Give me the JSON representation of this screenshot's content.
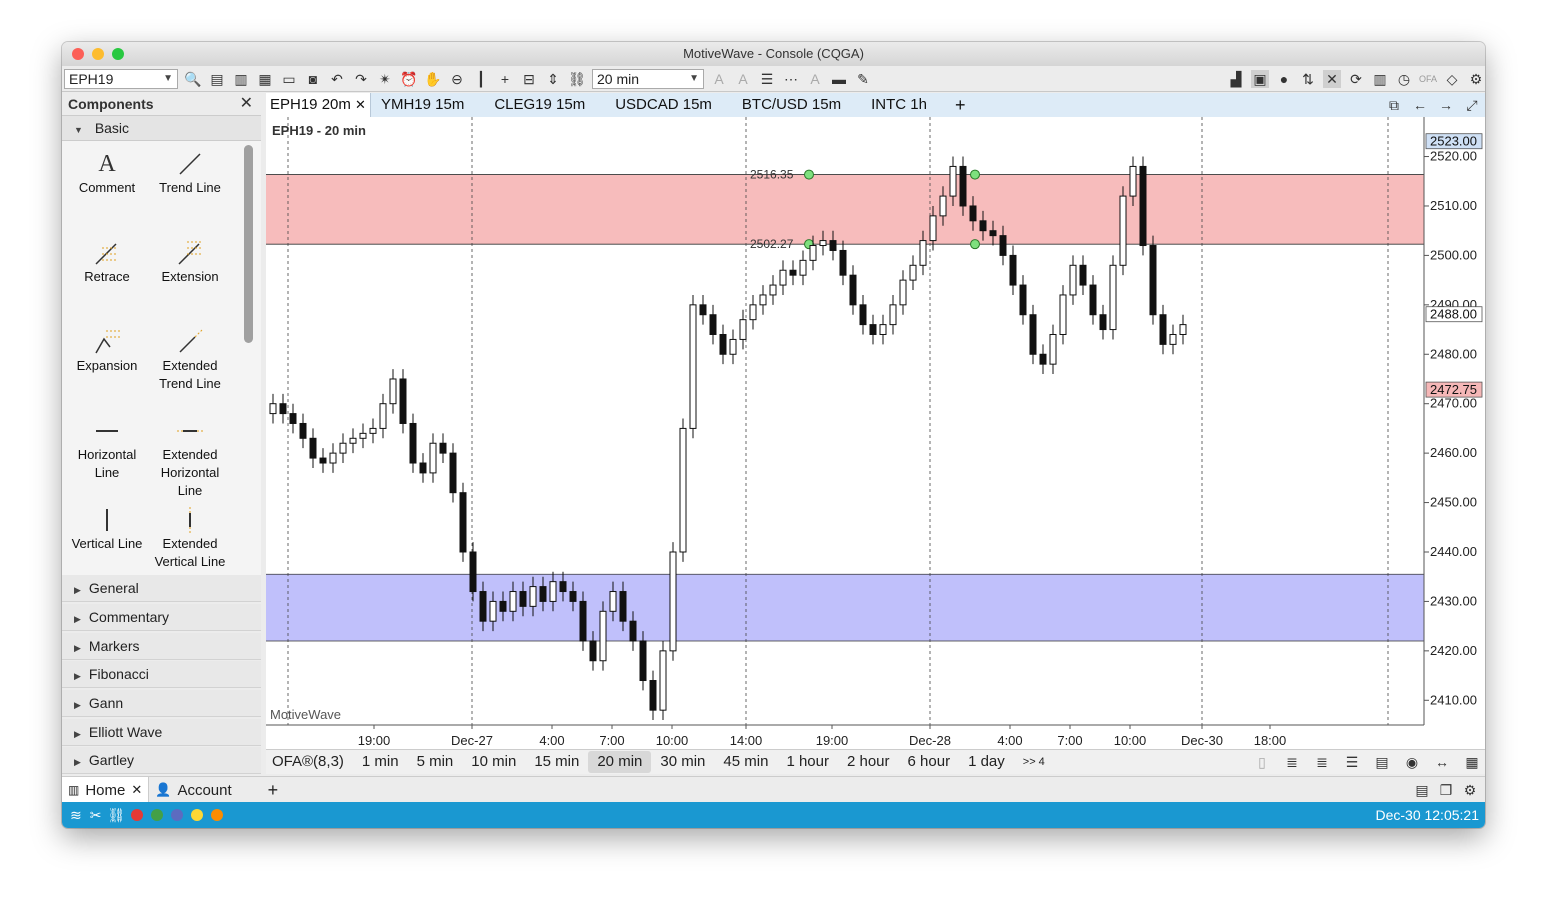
{
  "window": {
    "title": "MotiveWave - Console (CQGA)",
    "traffic_lights": [
      "#fc5f57",
      "#fdbc2e",
      "#28c840"
    ]
  },
  "toolbar": {
    "symbol": "EPH19",
    "timeframe": "20 min"
  },
  "components": {
    "title": "Components",
    "basic_section": "Basic",
    "tools": [
      {
        "label": "Comment",
        "icon": "text-icon"
      },
      {
        "label": "Trend Line",
        "icon": "trend-line-icon"
      },
      {
        "label": "Retrace",
        "icon": "retrace-icon"
      },
      {
        "label": "Extension",
        "icon": "extension-icon"
      },
      {
        "label": "Expansion",
        "icon": "expansion-icon"
      },
      {
        "label": "Extended Trend Line",
        "icon": "extended-trend-line-icon"
      },
      {
        "label": "Horizontal Line",
        "icon": "horizontal-line-icon"
      },
      {
        "label": "Extended Horizontal Line",
        "icon": "extended-horizontal-line-icon"
      },
      {
        "label": "Vertical Line",
        "icon": "vertical-line-icon"
      },
      {
        "label": "Extended Vertical Line",
        "icon": "extended-vertical-line-icon"
      }
    ],
    "categories": [
      "General",
      "Commentary",
      "Markers",
      "Fibonacci",
      "Gann",
      "Elliott Wave",
      "Gartley"
    ]
  },
  "chart_tabs": [
    "EPH19 20m",
    "YMH19 15m",
    "CLEG19 15m",
    "USDCAD 15m",
    "BTC/USD 15m",
    "INTC 1h"
  ],
  "chart": {
    "title": "EPH19 - 20 min",
    "watermark": "MotiveWave",
    "price_labels": [
      "2520.00",
      "2510.00",
      "2500.00",
      "2490.00",
      "2480.00",
      "2470.00",
      "2460.00",
      "2450.00",
      "2440.00",
      "2430.00",
      "2420.00",
      "2410.00"
    ],
    "price_badges": [
      {
        "text": "2523.00",
        "value": 2523.0,
        "color": "#cfe0f5"
      },
      {
        "text": "2488.00",
        "value": 2488.0,
        "color": "#ffffff"
      },
      {
        "text": "2472.75",
        "value": 2472.75,
        "color": "#f5b7b7"
      }
    ],
    "time_labels": [
      "19:00",
      "Dec-27",
      "4:00",
      "7:00",
      "10:00",
      "14:00",
      "19:00",
      "Dec-28",
      "4:00",
      "7:00",
      "10:00",
      "Dec-30",
      "18:00"
    ],
    "zone_labels": [
      "2516.35",
      "2502.27"
    ],
    "resistance_zone": [
      2502.27,
      2516.35
    ],
    "support_zone": [
      2422.0,
      2435.5
    ],
    "colors": {
      "resistance": "#f7bcbc",
      "support": "#c0c0fb"
    }
  },
  "timeframes": {
    "indicator": "OFA®(8,3)",
    "items": [
      "1 min",
      "5 min",
      "10 min",
      "15 min",
      "20 min",
      "30 min",
      "45 min",
      "1 hour",
      "2 hour",
      "6 hour",
      "1 day"
    ],
    "active": "20 min",
    "more": ">> 4"
  },
  "bottom_tabs": [
    "Home",
    "Account"
  ],
  "status": {
    "time": "Dec-30 12:05:21",
    "dots": [
      "#e53935",
      "#43a047",
      "#5c6bc0",
      "#fdd835",
      "#fb8c00"
    ]
  },
  "chart_data": {
    "type": "candlestick",
    "title": "EPH19 - 20 min",
    "ylim": [
      2405,
      2528
    ],
    "x": [
      "19:00",
      "Dec-27",
      "4:00",
      "7:00",
      "10:00",
      "14:00",
      "19:00",
      "Dec-28",
      "4:00",
      "7:00",
      "10:00",
      "Dec-30",
      "18:00"
    ],
    "close": [
      2470,
      2468,
      2466,
      2463,
      2459,
      2458,
      2460,
      2462,
      2463,
      2464,
      2465,
      2470,
      2475,
      2466,
      2458,
      2456,
      2462,
      2460,
      2452,
      2440,
      2432,
      2426,
      2430,
      2428,
      2432,
      2429,
      2433,
      2430,
      2434,
      2432,
      2430,
      2422,
      2418,
      2428,
      2432,
      2426,
      2422,
      2414,
      2408,
      2420,
      2440,
      2465,
      2490,
      2488,
      2484,
      2480,
      2483,
      2487,
      2490,
      2492,
      2494,
      2497,
      2496,
      2499,
      2502,
      2503,
      2501,
      2496,
      2490,
      2486,
      2484,
      2486,
      2490,
      2495,
      2498,
      2503,
      2508,
      2512,
      2518,
      2510,
      2507,
      2505,
      2504,
      2500,
      2494,
      2488,
      2480,
      2478,
      2484,
      2492,
      2498,
      2494,
      2488,
      2485,
      2498,
      2512,
      2518,
      2502,
      2488,
      2482,
      2484,
      2486
    ]
  }
}
